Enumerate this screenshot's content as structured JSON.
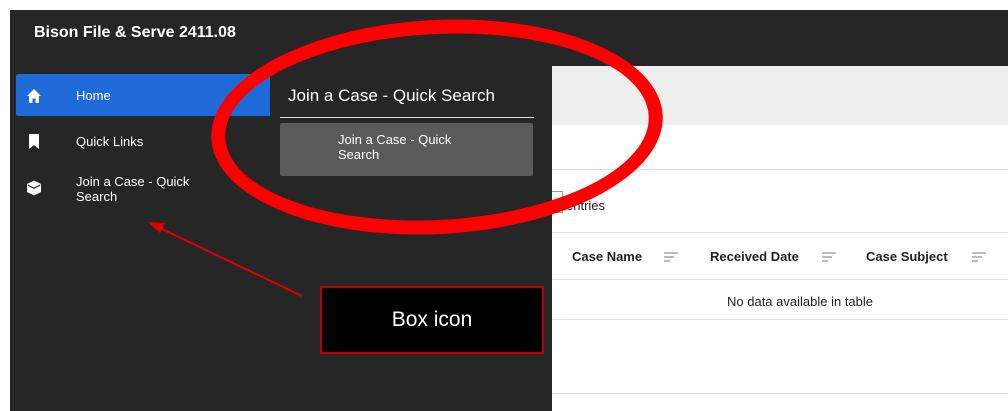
{
  "app": {
    "title": "Bison File & Serve 2411.08"
  },
  "sidebar": {
    "items": [
      {
        "label": "Home",
        "icon": "home-icon",
        "active": true
      },
      {
        "label": "Quick Links",
        "icon": "bookmark-icon",
        "active": false
      },
      {
        "label": "Join a Case - Quick Search",
        "icon": "box-icon",
        "active": false
      }
    ]
  },
  "flyout": {
    "title": "Join a Case - Quick Search",
    "item_label": "Join a Case - Quick Search"
  },
  "table": {
    "entries_label": "entries",
    "columns": [
      "Case Name",
      "Received Date",
      "Case Subject"
    ],
    "empty_message": "No data available in table"
  },
  "annotation": {
    "callout_text": "Box icon",
    "colors": {
      "ring": "#ff0000",
      "arrow": "#e00000",
      "callout_border": "#c00000"
    }
  },
  "colors": {
    "dark_bg": "#262626",
    "active_nav": "#1e6ad9",
    "flyout_item_bg": "#5a5a5a"
  }
}
